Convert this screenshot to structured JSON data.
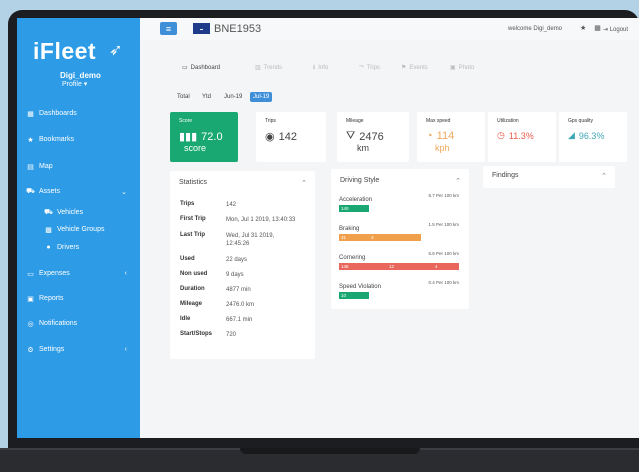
{
  "app": {
    "brand": "iFleet"
  },
  "user": {
    "name": "Digi_demo",
    "profile": "Profile"
  },
  "sidebar": {
    "items": [
      {
        "label": "Dashboards",
        "icon": "grid-icon"
      },
      {
        "label": "Bookmarks",
        "icon": "star-icon"
      },
      {
        "label": "Map",
        "icon": "map-icon"
      },
      {
        "label": "Assets",
        "icon": "car-icon"
      },
      {
        "label": "Vehicles",
        "icon": "car-icon"
      },
      {
        "label": "Vehicle Groups",
        "icon": "group-icon"
      },
      {
        "label": "Drivers",
        "icon": "user-icon"
      },
      {
        "label": "Expenses",
        "icon": "money-icon"
      },
      {
        "label": "Reports",
        "icon": "report-icon"
      },
      {
        "label": "Notifications",
        "icon": "bell-icon"
      },
      {
        "label": "Settings",
        "icon": "gear-icon"
      }
    ]
  },
  "header": {
    "vehicle_id": "BNE1953",
    "welcome": "welcome Digi_demo",
    "logout": "Logout"
  },
  "tabs": [
    {
      "label": "Dashboard",
      "active": true
    },
    {
      "label": "Trends",
      "active": false
    },
    {
      "label": "Info",
      "active": false
    },
    {
      "label": "Trips",
      "active": false
    },
    {
      "label": "Events",
      "active": false
    },
    {
      "label": "Photo",
      "active": false
    }
  ],
  "filters": [
    {
      "label": "Total",
      "active": false
    },
    {
      "label": "Ytd",
      "active": false
    },
    {
      "label": "Jun-19",
      "active": false
    },
    {
      "label": "Jul-19",
      "active": true
    }
  ],
  "kpis": {
    "score": {
      "label": "Score",
      "value": "72.0",
      "unit": "score"
    },
    "trips": {
      "label": "Trips",
      "value": "142"
    },
    "mileage": {
      "label": "Mileage",
      "value": "2476",
      "unit": "km"
    },
    "max_speed": {
      "label": "Max speed",
      "value": "114",
      "unit": "kph"
    },
    "utilization": {
      "label": "Utilization",
      "value": "11.3%"
    },
    "gps": {
      "label": "Gps quality",
      "value": "96.3%"
    }
  },
  "statistics": {
    "title": "Statistics",
    "rows": [
      {
        "k": "Trips",
        "v": "142"
      },
      {
        "k": "First Trip",
        "v": "Mon, Jul 1 2019, 13:40:33"
      },
      {
        "k": "Last Trip",
        "v": "Wed, Jul 31 2019, 12:45:26"
      },
      {
        "k": "Used",
        "v": "22 days"
      },
      {
        "k": "Non used",
        "v": "9 days"
      },
      {
        "k": "Duration",
        "v": "4877 min"
      },
      {
        "k": "Mileage",
        "v": "2476.0 km"
      },
      {
        "k": "Idle",
        "v": "667.1 min"
      },
      {
        "k": "Start/Stops",
        "v": "720"
      }
    ]
  },
  "driving": {
    "title": "Driving Style",
    "items": [
      {
        "label": "Acceleration",
        "rate": "5.7 Per 100 km",
        "segs": [
          {
            "v": "140",
            "c": "#1aa872",
            "w": 30
          }
        ]
      },
      {
        "label": "Braking",
        "rate": "1.5 Per 100 km",
        "segs": [
          {
            "v": "31",
            "c": "#f0a04b",
            "w": 30
          },
          {
            "v": "3",
            "c": "#f0a04b",
            "w": 52
          }
        ]
      },
      {
        "label": "Cornering",
        "rate": "6.6 Per 100 km",
        "segs": [
          {
            "v": "148",
            "c": "#e8665b",
            "w": 48
          },
          {
            "v": "12",
            "c": "#e8665b",
            "w": 46
          },
          {
            "v": "4",
            "c": "#e8665b",
            "w": 26
          }
        ]
      },
      {
        "label": "Speed Violation",
        "rate": "0.4 Per 100 km",
        "segs": [
          {
            "v": "10",
            "c": "#1aa872",
            "w": 30
          }
        ]
      }
    ]
  },
  "findings": {
    "title": "Findings"
  }
}
